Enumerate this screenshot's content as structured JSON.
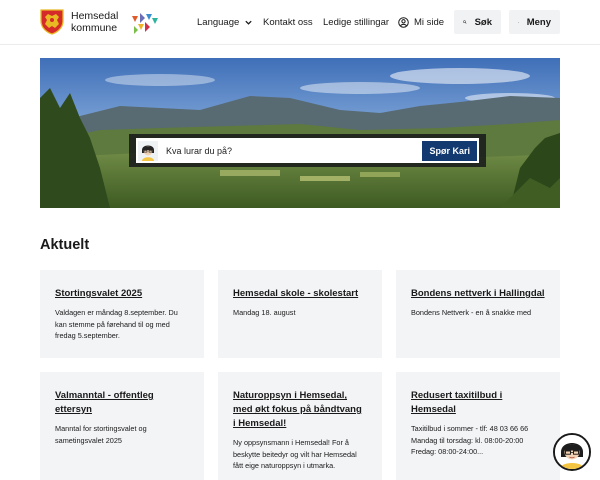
{
  "header": {
    "brand_line1": "Hemsedal",
    "brand_line2": "kommune",
    "nav": {
      "language": "Language",
      "contact": "Kontakt oss",
      "jobs": "Ledige stillingar",
      "my_page": "Mi side"
    },
    "search_label": "Søk",
    "menu_label": "Meny"
  },
  "hero": {
    "search_placeholder": "Kva lurar du på?",
    "search_button": "Spør Kari"
  },
  "news": {
    "title": "Aktuelt",
    "items": [
      {
        "title": "Stortingsvalet 2025",
        "desc": "Valdagen er måndag 8.september. Du kan stemme på førehand til og med fredag 5.september."
      },
      {
        "title": "Hemsedal skole - skolestart",
        "desc": "Mandag 18. august"
      },
      {
        "title": "Bondens nettverk i Hallingdal",
        "desc": "Bondens Nettverk - en å snakke med"
      },
      {
        "title": "Valmanntal - offentleg ettersyn",
        "desc": "Manntal for stortingsvalet og sametingsvalet 2025"
      },
      {
        "title": "Naturoppsyn i Hemsedal, med økt fokus på båndtvang i Hemsedal!",
        "desc": "Ny oppsynsmann i Hemsedal! For å beskytte beitedyr og vilt har Hemsedal fått eige naturoppsyn i utmarka."
      },
      {
        "title": "Redusert taxitilbud i Hemsedal",
        "desc": "Taxitilbud i sommer - tlf: 48 03 66 66\nMandag til torsdag: kl. 08:00-20:00\nFredag: 08:00-24:00..."
      }
    ]
  },
  "colors": {
    "accent": "#123a70",
    "shield_red": "#d42a2a",
    "shield_gold": "#e8b923",
    "card_bg": "#f3f4f6"
  }
}
